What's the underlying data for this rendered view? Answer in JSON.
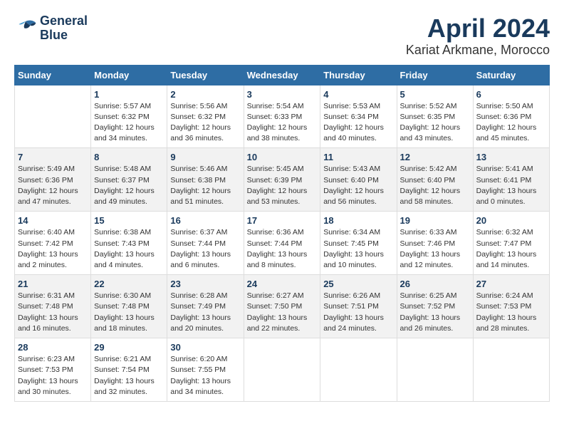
{
  "header": {
    "logo_line1": "General",
    "logo_line2": "Blue",
    "month": "April 2024",
    "location": "Kariat Arkmane, Morocco"
  },
  "weekdays": [
    "Sunday",
    "Monday",
    "Tuesday",
    "Wednesday",
    "Thursday",
    "Friday",
    "Saturday"
  ],
  "weeks": [
    {
      "row_style": "white-row",
      "days": [
        {
          "number": "",
          "info": ""
        },
        {
          "number": "1",
          "info": "Sunrise: 5:57 AM\nSunset: 6:32 PM\nDaylight: 12 hours\nand 34 minutes."
        },
        {
          "number": "2",
          "info": "Sunrise: 5:56 AM\nSunset: 6:32 PM\nDaylight: 12 hours\nand 36 minutes."
        },
        {
          "number": "3",
          "info": "Sunrise: 5:54 AM\nSunset: 6:33 PM\nDaylight: 12 hours\nand 38 minutes."
        },
        {
          "number": "4",
          "info": "Sunrise: 5:53 AM\nSunset: 6:34 PM\nDaylight: 12 hours\nand 40 minutes."
        },
        {
          "number": "5",
          "info": "Sunrise: 5:52 AM\nSunset: 6:35 PM\nDaylight: 12 hours\nand 43 minutes."
        },
        {
          "number": "6",
          "info": "Sunrise: 5:50 AM\nSunset: 6:36 PM\nDaylight: 12 hours\nand 45 minutes."
        }
      ]
    },
    {
      "row_style": "alt-row",
      "days": [
        {
          "number": "7",
          "info": "Sunrise: 5:49 AM\nSunset: 6:36 PM\nDaylight: 12 hours\nand 47 minutes."
        },
        {
          "number": "8",
          "info": "Sunrise: 5:48 AM\nSunset: 6:37 PM\nDaylight: 12 hours\nand 49 minutes."
        },
        {
          "number": "9",
          "info": "Sunrise: 5:46 AM\nSunset: 6:38 PM\nDaylight: 12 hours\nand 51 minutes."
        },
        {
          "number": "10",
          "info": "Sunrise: 5:45 AM\nSunset: 6:39 PM\nDaylight: 12 hours\nand 53 minutes."
        },
        {
          "number": "11",
          "info": "Sunrise: 5:43 AM\nSunset: 6:40 PM\nDaylight: 12 hours\nand 56 minutes."
        },
        {
          "number": "12",
          "info": "Sunrise: 5:42 AM\nSunset: 6:40 PM\nDaylight: 12 hours\nand 58 minutes."
        },
        {
          "number": "13",
          "info": "Sunrise: 5:41 AM\nSunset: 6:41 PM\nDaylight: 13 hours\nand 0 minutes."
        }
      ]
    },
    {
      "row_style": "white-row",
      "days": [
        {
          "number": "14",
          "info": "Sunrise: 6:40 AM\nSunset: 7:42 PM\nDaylight: 13 hours\nand 2 minutes."
        },
        {
          "number": "15",
          "info": "Sunrise: 6:38 AM\nSunset: 7:43 PM\nDaylight: 13 hours\nand 4 minutes."
        },
        {
          "number": "16",
          "info": "Sunrise: 6:37 AM\nSunset: 7:44 PM\nDaylight: 13 hours\nand 6 minutes."
        },
        {
          "number": "17",
          "info": "Sunrise: 6:36 AM\nSunset: 7:44 PM\nDaylight: 13 hours\nand 8 minutes."
        },
        {
          "number": "18",
          "info": "Sunrise: 6:34 AM\nSunset: 7:45 PM\nDaylight: 13 hours\nand 10 minutes."
        },
        {
          "number": "19",
          "info": "Sunrise: 6:33 AM\nSunset: 7:46 PM\nDaylight: 13 hours\nand 12 minutes."
        },
        {
          "number": "20",
          "info": "Sunrise: 6:32 AM\nSunset: 7:47 PM\nDaylight: 13 hours\nand 14 minutes."
        }
      ]
    },
    {
      "row_style": "alt-row",
      "days": [
        {
          "number": "21",
          "info": "Sunrise: 6:31 AM\nSunset: 7:48 PM\nDaylight: 13 hours\nand 16 minutes."
        },
        {
          "number": "22",
          "info": "Sunrise: 6:30 AM\nSunset: 7:48 PM\nDaylight: 13 hours\nand 18 minutes."
        },
        {
          "number": "23",
          "info": "Sunrise: 6:28 AM\nSunset: 7:49 PM\nDaylight: 13 hours\nand 20 minutes."
        },
        {
          "number": "24",
          "info": "Sunrise: 6:27 AM\nSunset: 7:50 PM\nDaylight: 13 hours\nand 22 minutes."
        },
        {
          "number": "25",
          "info": "Sunrise: 6:26 AM\nSunset: 7:51 PM\nDaylight: 13 hours\nand 24 minutes."
        },
        {
          "number": "26",
          "info": "Sunrise: 6:25 AM\nSunset: 7:52 PM\nDaylight: 13 hours\nand 26 minutes."
        },
        {
          "number": "27",
          "info": "Sunrise: 6:24 AM\nSunset: 7:53 PM\nDaylight: 13 hours\nand 28 minutes."
        }
      ]
    },
    {
      "row_style": "white-row",
      "days": [
        {
          "number": "28",
          "info": "Sunrise: 6:23 AM\nSunset: 7:53 PM\nDaylight: 13 hours\nand 30 minutes."
        },
        {
          "number": "29",
          "info": "Sunrise: 6:21 AM\nSunset: 7:54 PM\nDaylight: 13 hours\nand 32 minutes."
        },
        {
          "number": "30",
          "info": "Sunrise: 6:20 AM\nSunset: 7:55 PM\nDaylight: 13 hours\nand 34 minutes."
        },
        {
          "number": "",
          "info": ""
        },
        {
          "number": "",
          "info": ""
        },
        {
          "number": "",
          "info": ""
        },
        {
          "number": "",
          "info": ""
        }
      ]
    }
  ]
}
